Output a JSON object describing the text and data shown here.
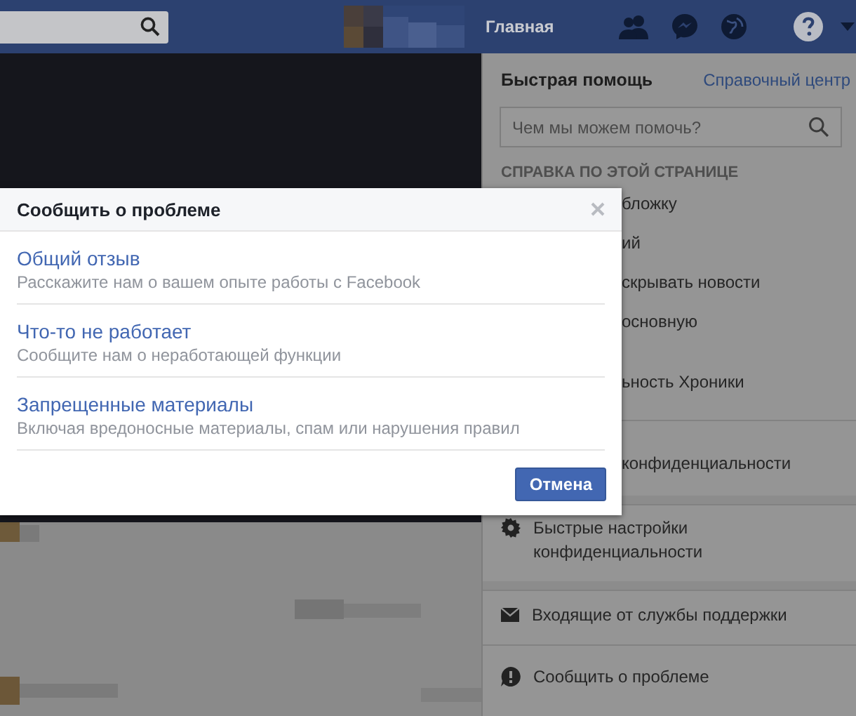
{
  "top_bar": {
    "nav_link": "Главная"
  },
  "help_menu": {
    "title": "Быстрая помощь",
    "link": "Справочный центр",
    "search": {
      "placeholder": "Чем мы можем помочь?"
    },
    "sections": [
      {
        "heading": "СПРАВКА ПО ЭТОЙ СТРАНИЦЕ",
        "items": [
          {
            "kind": "covered",
            "label": "бложку"
          },
          {
            "kind": "covered",
            "label": "ий"
          },
          {
            "kind": "covered",
            "label": "скрывать новости"
          },
          {
            "kind": "covered",
            "label": "основную"
          },
          {
            "kind": "covered",
            "label": "ьность Хроники"
          }
        ]
      },
      {
        "items": [
          {
            "kind": "covered",
            "label": "конфиденциальности"
          }
        ]
      },
      {
        "items": [
          {
            "kind": "gear",
            "label": "Быстрые настройки конфиденциальности"
          }
        ]
      },
      {
        "items": [
          {
            "kind": "envelope",
            "label": "Входящие от службы поддержки"
          }
        ]
      },
      {
        "items": [
          {
            "kind": "alert",
            "label": "Сообщить о проблеме"
          }
        ]
      }
    ]
  },
  "dialog": {
    "title": "Сообщить о проблеме",
    "options": [
      {
        "title": "Общий отзыв",
        "description": "Расскажите нам о вашем опыте работы с Facebook"
      },
      {
        "title": "Что-то не работает",
        "description": "Сообщите нам о неработающей функции"
      },
      {
        "title": "Запрещенные материалы",
        "description": "Включая вредоносные материалы, спам или нарушения правил"
      }
    ],
    "buttons": [
      "Отмена"
    ]
  }
}
